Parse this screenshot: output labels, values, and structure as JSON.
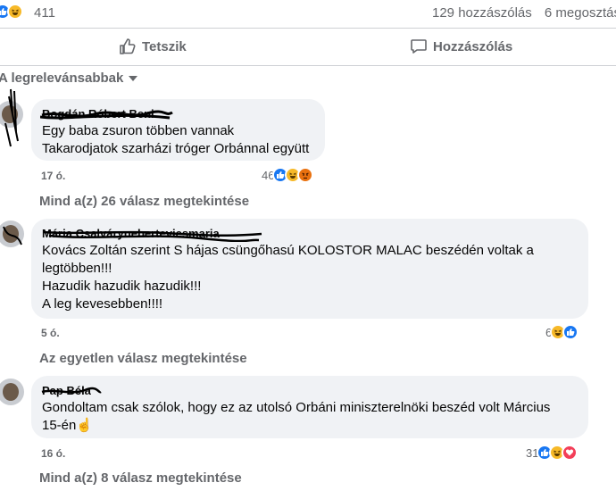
{
  "post_stats": {
    "reaction_count": "411",
    "comments": "129 hozzászólás",
    "shares": "6 megosztás",
    "reaction_icons": [
      "like-icon",
      "haha-icon"
    ]
  },
  "actions": {
    "like_label": "Tetszik",
    "comment_label": "Hozzászólás"
  },
  "sort": {
    "label": "A legrelevánsabbak"
  },
  "comments": [
    {
      "author": "Bogdán Róbert Beni",
      "lines": "Egy baba zsuron többen vannak\nTakarodjatok szarházi tróger Orbánnal együtt",
      "time": "17 ó.",
      "reaction_count": "46",
      "reaction_icons": [
        "like-icon",
        "haha-icon",
        "angry-icon"
      ],
      "replies_link": "Mind a(z) 26 válasz megtekintése"
    },
    {
      "author": "Mária Csalváryneberteviesmaria",
      "lines": "Kovács Zoltán szerint S hájas csüngőhasú KOLOSTOR MALAC beszédén voltak a\nlegtöbben!!!\nHazudik hazudik hazudik!!!\nA leg kevesebben!!!!",
      "time": "5 ó.",
      "reaction_count": "6",
      "reaction_icons": [
        "haha-icon",
        "like-icon"
      ],
      "replies_link": "Az egyetlen válasz megtekintése"
    },
    {
      "author": "Pap Béla",
      "lines": "Gondoltam csak szólok, hogy ez az utolsó Orbáni miniszterelnöki beszéd volt Március\n15-én☝️",
      "time": "16 ó.",
      "reaction_count": "31",
      "reaction_icons": [
        "like-icon",
        "haha-icon",
        "love-icon"
      ],
      "replies_link": "Mind a(z) 8 válasz megtekintése"
    }
  ],
  "colors": {
    "secondary_text": "#65676b",
    "bubble_bg": "#f0f2f5",
    "like_blue": "#1877f2",
    "haha_yellow": "#f7b928",
    "angry_orange": "#e9710f",
    "love_red": "#f33e58"
  }
}
